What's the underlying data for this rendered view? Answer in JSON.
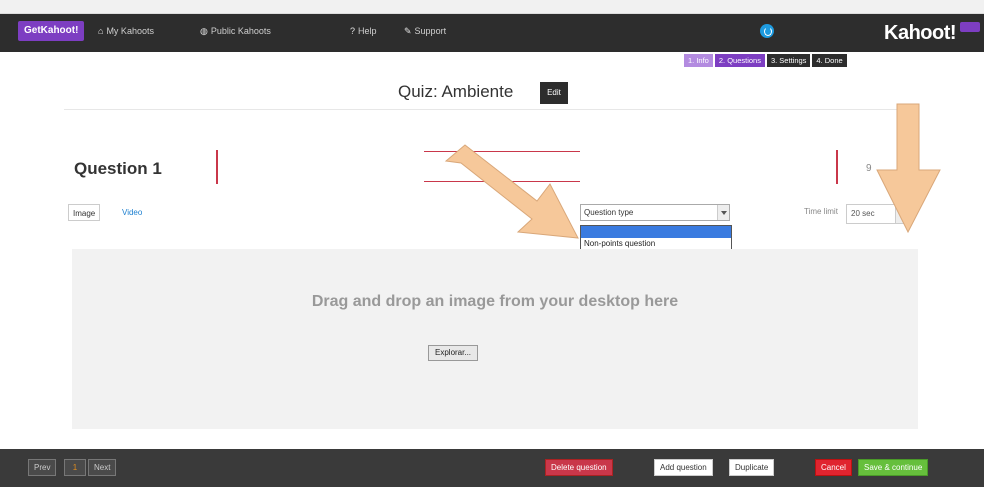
{
  "browser": {
    "strip_text": ""
  },
  "topbar": {
    "brand": "GetKahoot!",
    "nav": [
      {
        "label": "My Kahoots",
        "icon": "home-icon"
      },
      {
        "label": "Public Kahoots",
        "icon": "globe-icon"
      },
      {
        "label": "Help",
        "icon": "help-icon"
      },
      {
        "label": "Support",
        "icon": "chat-icon"
      }
    ],
    "user_name": "",
    "logo": "Kahoot!"
  },
  "steps": [
    {
      "label": "1. Info",
      "state": "done"
    },
    {
      "label": "2. Questions",
      "state": "active"
    },
    {
      "label": "3. Settings",
      "state": "todo"
    },
    {
      "label": "4. Done",
      "state": "todo"
    }
  ],
  "quiz": {
    "title": "Quiz: Ambiente",
    "edit_label": "Edit"
  },
  "question": {
    "label": "Question 1",
    "tabs": {
      "image": "Image",
      "video": "Video"
    },
    "type_select": "Question type",
    "type_options": [
      "",
      "Non-points question"
    ],
    "time_limit_label": "Time limit",
    "time_limit_value": "20 sec"
  },
  "dropzone": {
    "title": "Drag and drop an image from your desktop here",
    "or": "",
    "browse": "Explorar...",
    "file_label": "",
    "note": ""
  },
  "bottombar": {
    "prev": "Prev",
    "page": "1",
    "next": "Next",
    "delete": "Delete question",
    "add": "Add question",
    "duplicate": "Duplicate",
    "cancel": "Cancel",
    "save": "Save & continue"
  },
  "colors": {
    "purple": "#7d3ec2",
    "red": "#c9374a",
    "green": "#66bf3c",
    "arrow": "#f6c89a"
  }
}
